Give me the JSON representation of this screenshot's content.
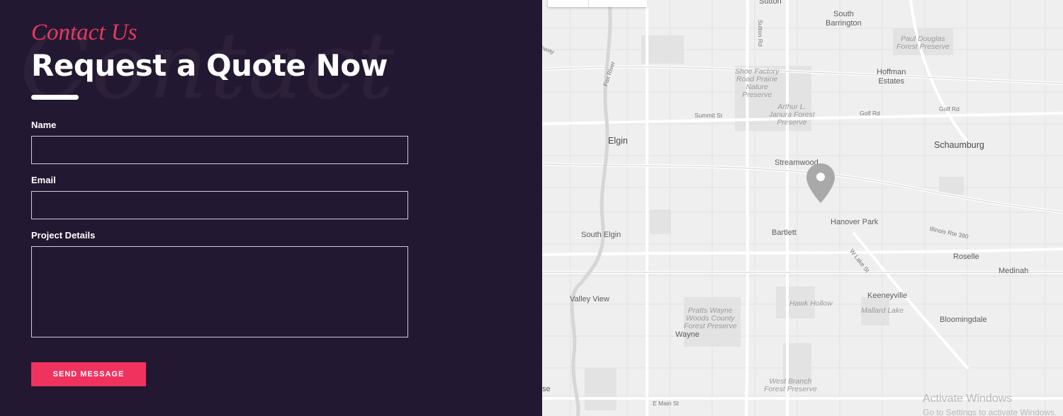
{
  "contact": {
    "watermark": "Contact",
    "kicker": "Contact Us",
    "heading_prefix": "Request a Quote",
    "heading_highlight": "Now",
    "accent_color": "#e8385e",
    "background_color": "#231831"
  },
  "form": {
    "name_label": "Name",
    "name_value": "",
    "email_label": "Email",
    "email_value": "",
    "details_label": "Project Details",
    "details_value": "",
    "submit_label": "SEND MESSAGE"
  },
  "map": {
    "places": {
      "sutton": "Sutton",
      "south_barrington": "South\nBarrington",
      "paul_douglas": "Paul Douglas\nForest Preserve",
      "hoffman_estates": "Hoffman\nEstates",
      "shoe_factory": "Shoe Factory\nRoad Prairie\nNature\nPreserve",
      "arthur_janura": "Arthur L.\nJanura Forest\nPreserve",
      "elgin": "Elgin",
      "schaumburg": "Schaumburg",
      "streamwood": "Streamwood",
      "south_elgin": "South Elgin",
      "bartlett": "Bartlett",
      "hanover_park": "Hanover Park",
      "roselle": "Roselle",
      "medinah": "Medinah",
      "valley_view": "Valley View",
      "keeneyville": "Keeneyville",
      "hawk_hollow": "Hawk Hollow",
      "mallard_lake": "Mallard Lake",
      "pratts_wayne": "Pratts Wayne\nWoods County\nForest Preserve",
      "bloomingdale": "Bloomingdale",
      "wayne": "Wayne",
      "west_branch": "West Branch\nForest Preserve"
    },
    "roads": {
      "sutton_rd": "Sutton Rd",
      "summit_st": "Summit St",
      "golf_rd_1": "Golf Rd",
      "golf_rd_2": "Golf Rd",
      "illinois_rte_390": "Illinois Rte 390",
      "w_lake_st": "W Lake St",
      "e_main_st": "E Main St",
      "fox_river": "Fox River",
      "highway": "hway"
    },
    "edge_fragment": "se",
    "pin_icon": "map-pin-icon"
  },
  "os_overlay": {
    "title": "Activate Windows",
    "subtitle": "Go to Settings to activate Windows."
  }
}
